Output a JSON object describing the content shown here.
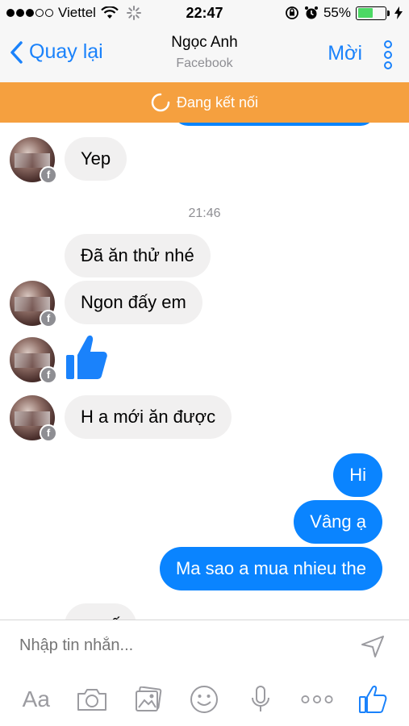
{
  "status": {
    "carrier": "Viettel",
    "time": "22:47",
    "battery": "55%",
    "battery_level": 0.55,
    "signal_bars": 3
  },
  "nav": {
    "back_label": "Quay lại",
    "title": "Ngọc Anh",
    "subtitle": "Facebook",
    "invite_label": "Mời"
  },
  "banner": {
    "text": "Đang kết nối"
  },
  "chat": {
    "timestamp": "21:46",
    "messages": [
      {
        "side": "in",
        "text": "Yep"
      },
      {
        "side": "in",
        "text": "Đã ăn thử nhé"
      },
      {
        "side": "in",
        "text": "Ngon đấy em"
      },
      {
        "side": "in",
        "type": "like"
      },
      {
        "side": "in",
        "text": "H a mới ăn được"
      },
      {
        "side": "out",
        "text": "Hi"
      },
      {
        "side": "out",
        "text": "Vâng ạ"
      },
      {
        "side": "out",
        "text": "Ma sao a mua nhieu the"
      }
    ],
    "partial_text": "... ..ế"
  },
  "composer": {
    "placeholder": "Nhập tin nhắn...",
    "text_tool_label": "Aa",
    "more_label": "ooo"
  },
  "colors": {
    "accent": "#1a82fb",
    "outgoing_bubble": "#0a84ff",
    "incoming_bubble": "#f1f0f0",
    "banner": "#f5a03f"
  }
}
